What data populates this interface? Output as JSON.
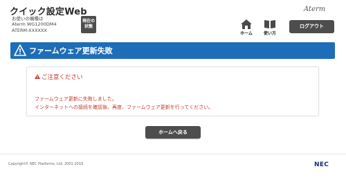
{
  "header": {
    "app_title": "クイック設定Web",
    "device_caption": "お使いの機種は",
    "device_model": "Aterm WG1200DM4",
    "device_id": "ATERM-XXXXXX",
    "status_button": [
      "現在の",
      "状態"
    ],
    "brand_logo": "Aterm",
    "nav_home_label": "ホーム",
    "nav_manual_label": "使い方",
    "logout_label": "ログアウト"
  },
  "page": {
    "title": "ファームウェア更新失敗"
  },
  "notice": {
    "title": "ご注意ください",
    "lines": [
      "ファームウェア更新に失敗しました。",
      "インターネットへの接続を確認後、再度、ファームウェア更新を行ってください。"
    ]
  },
  "actions": {
    "home_back_label": "ホームへ戻る"
  },
  "footer": {
    "copyright": "Copyright© NEC Platforms, Ltd. 2001-2019",
    "company_logo": "NEC"
  },
  "colors": {
    "title_bar": "#1e6db8",
    "button_bg": "#4d4d4d",
    "warning_text": "#c0392b"
  },
  "icons": [
    "home-icon",
    "book-icon",
    "warning-icon"
  ]
}
